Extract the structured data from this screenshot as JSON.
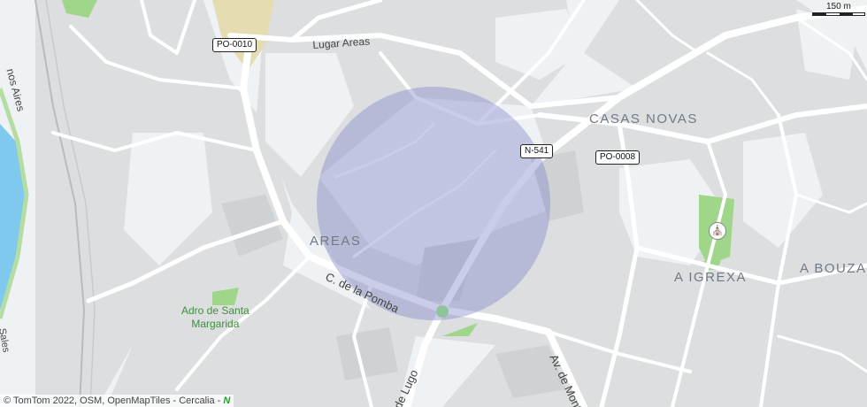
{
  "map": {
    "places": {
      "casas_novas": "CASAS NOVAS",
      "areas": "AREAS",
      "a_igrexa": "A IGREXA",
      "a_bouza": "A BOUZA"
    },
    "parks": {
      "adro_line1": "Adro de Santa",
      "adro_line2": "Margarida"
    },
    "streets": {
      "lugar_areas": "Lugar Areas",
      "c_de_la_pomba": "C. de la Pomba",
      "av_de_lugo": "de Lugo",
      "av_de_monte": "Av. de Mont",
      "buenos_aires": "nos Aires",
      "sales": "Sales"
    },
    "shields": {
      "po0010": "PO-0010",
      "n541": "N-541",
      "po0008": "PO-0008"
    },
    "poi_icon": "church-icon",
    "colors": {
      "background": "#eef2f5",
      "built_area": "#dcdedf",
      "road": "#ffffff",
      "water": "#7fc8ee",
      "park": "#9fd68a",
      "highlight": "#8a8fcc"
    }
  },
  "scale": {
    "label": "150 m"
  },
  "attribution": {
    "text": "© TomTom 2022, OSM, OpenMapTiles - Cercalia -",
    "logo": "N"
  }
}
